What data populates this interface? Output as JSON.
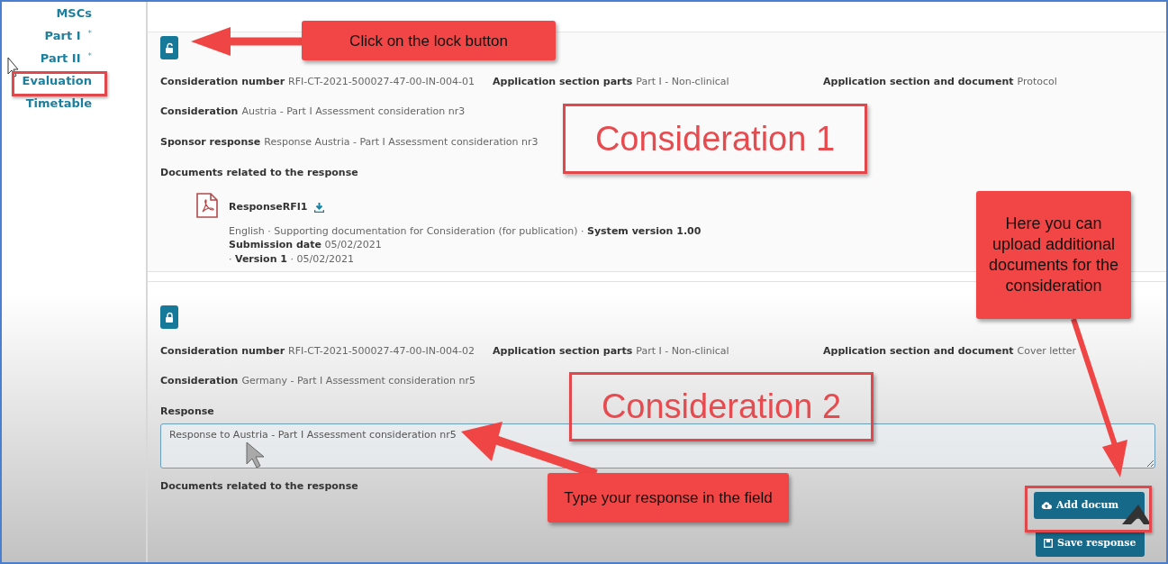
{
  "sidebar": {
    "items": [
      {
        "label": "MSCs"
      },
      {
        "label": "Part I",
        "marker": "*"
      },
      {
        "label": "Part II",
        "marker": "*"
      },
      {
        "label": "Evaluation"
      },
      {
        "label": "Timetable"
      }
    ]
  },
  "considerations": [
    {
      "locked": false,
      "fields": [
        {
          "label": "Consideration number",
          "value": "RFI-CT-2021-500027-47-00-IN-004-01"
        },
        {
          "label": "Application section parts",
          "value": "Part I - Non-clinical"
        },
        {
          "label": "Application section and document",
          "value": "Protocol"
        }
      ],
      "consideration": {
        "label": "Consideration",
        "value": "Austria - Part I Assessment consideration nr3"
      },
      "sponsor_response": {
        "label": "Sponsor response",
        "value": "Response Austria - Part I Assessment consideration nr3"
      },
      "documents_heading": "Documents related to the response",
      "document": {
        "name": "ResponseRFI1",
        "details": [
          "English · Supporting documentation for Consideration (for publication) · **System version 1.00**",
          "**Submission date** 05/02/2021",
          "· **Version 1** · 05/02/2021"
        ]
      }
    },
    {
      "locked": true,
      "fields": [
        {
          "label": "Consideration number",
          "value": "RFI-CT-2021-500027-47-00-IN-004-02"
        },
        {
          "label": "Application section parts",
          "value": "Part I - Non-clinical"
        },
        {
          "label": "Application section and document",
          "value": "Cover letter"
        }
      ],
      "consideration": {
        "label": "Consideration",
        "value": "Germany - Part I Assessment consideration nr5"
      },
      "response": {
        "label": "Response",
        "value": "Response to Austria - Part I Assessment consideration nr5"
      },
      "documents_heading": "Documents related to the response",
      "buttons": [
        {
          "kind": "upload",
          "label": "Add docum"
        },
        {
          "kind": "save",
          "label": "Save response"
        }
      ]
    }
  ],
  "annotations": [
    {
      "kind": "callout",
      "text": "Click on the lock button"
    },
    {
      "kind": "heading",
      "text": "Consideration 1"
    },
    {
      "kind": "callout",
      "text": "Here you can upload additional documents for the consideration"
    },
    {
      "kind": "heading",
      "text": "Consideration 2"
    },
    {
      "kind": "callout",
      "text": "Type your response in the field"
    },
    {
      "kind": "highlight"
    },
    {
      "kind": "highlight"
    }
  ]
}
